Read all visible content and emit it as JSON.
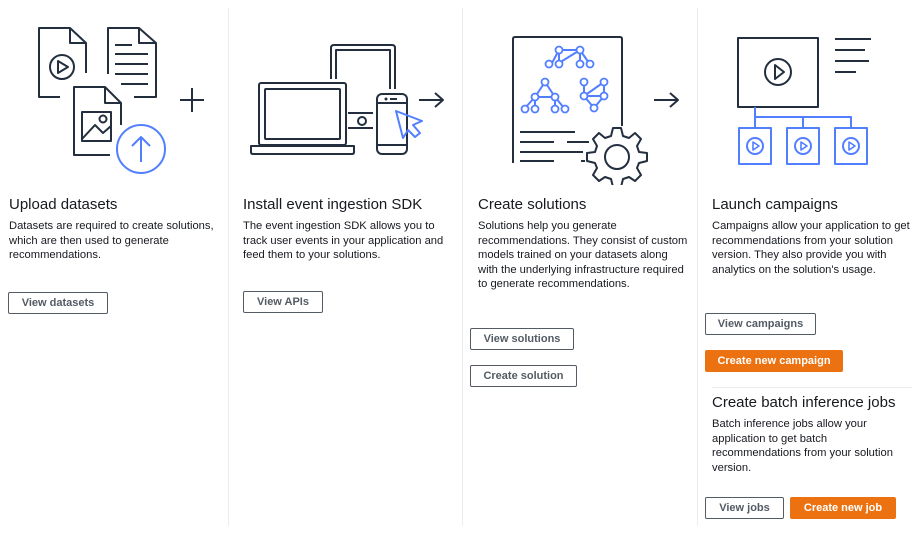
{
  "columns": [
    {
      "id": "upload-datasets",
      "illustration": "upload-documents-icon",
      "connector": "plus-icon",
      "title": "Upload datasets",
      "description": "Datasets are required to create solutions, which are then used to generate recommendations.",
      "buttons": [
        {
          "label": "View datasets",
          "style": "normal"
        }
      ]
    },
    {
      "id": "install-sdk",
      "illustration": "devices-cursor-icon",
      "connector": "arrow-right-icon",
      "title": "Install event ingestion SDK",
      "description": "The event ingestion SDK allows you to track user events in your application and feed them to your solutions.",
      "buttons": [
        {
          "label": "View APIs",
          "style": "normal"
        }
      ]
    },
    {
      "id": "create-solutions",
      "illustration": "model-document-gear-icon",
      "connector": "arrow-right-icon",
      "title": "Create solutions",
      "description": "Solutions help you generate recommendations. They consist of custom models trained on your datasets along with the underlying infrastructure required to generate recommendations.",
      "buttons": [
        {
          "label": "View solutions",
          "style": "normal"
        },
        {
          "label": "Create solution",
          "style": "normal"
        }
      ]
    },
    {
      "id": "launch-campaigns",
      "illustration": "video-distribution-icon",
      "title": "Launch campaigns",
      "description": "Campaigns allow your application to get recommendations from your solution version. They also provide you with analytics on the solution's usage.",
      "buttons": [
        {
          "label": "View campaigns",
          "style": "normal"
        },
        {
          "label": "Create new campaign",
          "style": "primary"
        }
      ],
      "subsection": {
        "title": "Create batch inference jobs",
        "description": "Batch inference jobs allow your application to get batch recommendations from your solution version.",
        "buttons": [
          {
            "label": "View jobs",
            "style": "normal"
          },
          {
            "label": "Create new job",
            "style": "primary"
          }
        ]
      }
    }
  ],
  "colors": {
    "primary": "#ec7211",
    "icon_dark": "#232f3e",
    "icon_accent": "#527fff",
    "button_border": "#545b64",
    "divider": "#eaeded"
  }
}
